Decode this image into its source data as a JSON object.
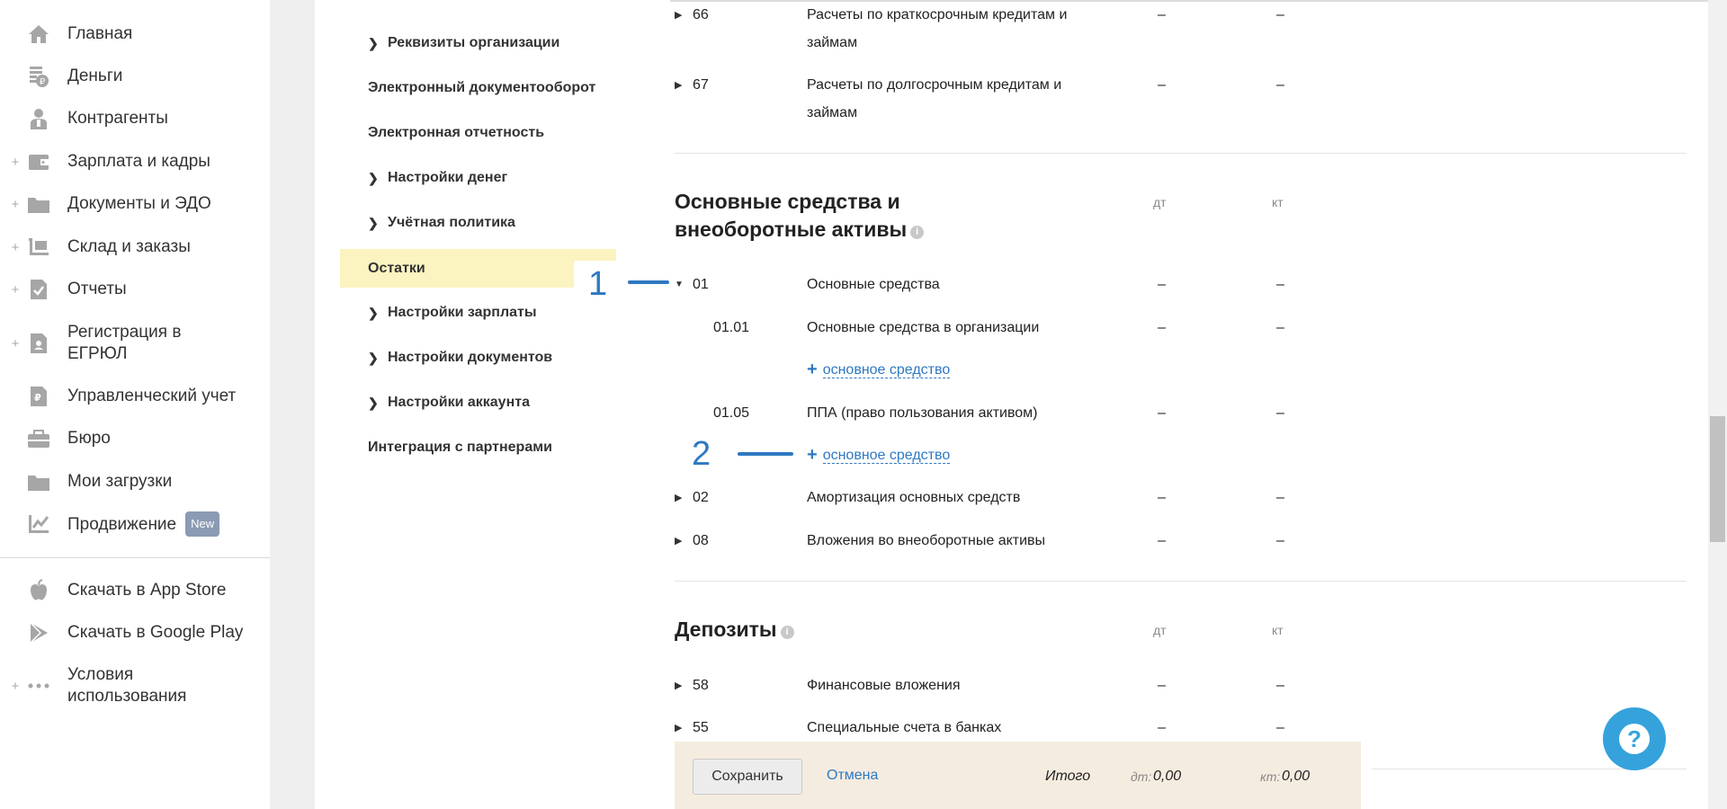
{
  "nav": {
    "items": [
      {
        "label": "Главная",
        "icon": "home-icon",
        "plus": false
      },
      {
        "label": "Деньги",
        "icon": "money-icon",
        "plus": false
      },
      {
        "label": "Контрагенты",
        "icon": "contractors-icon",
        "plus": false
      },
      {
        "label": "Зарплата и кадры",
        "icon": "wallet-icon",
        "plus": true
      },
      {
        "label": "Документы и ЭДО",
        "icon": "folder-icon",
        "plus": true
      },
      {
        "label": "Склад и заказы",
        "icon": "cart-icon",
        "plus": true
      },
      {
        "label": "Отчеты",
        "icon": "report-icon",
        "plus": true
      },
      {
        "label": "Регистрация в ЕГРЮЛ",
        "icon": "registration-icon",
        "plus": true
      },
      {
        "label": "Управленческий учет",
        "icon": "management-icon",
        "plus": false
      },
      {
        "label": "Бюро",
        "icon": "briefcase-icon",
        "plus": false
      },
      {
        "label": "Мои загрузки",
        "icon": "downloads-icon",
        "plus": false
      },
      {
        "label": "Продвижение",
        "icon": "promotion-icon",
        "plus": false,
        "badge": "New"
      },
      {
        "label": "Скачать в App Store",
        "icon": "apple-icon",
        "plus": false
      },
      {
        "label": "Скачать в Google Play",
        "icon": "google-play-icon",
        "plus": false
      },
      {
        "label": "Условия использования",
        "icon": "more-icon",
        "plus": true
      }
    ]
  },
  "settings": {
    "items": [
      {
        "label": "Реквизиты организации",
        "chevron": true
      },
      {
        "label": "Электронный документооборот",
        "chevron": false
      },
      {
        "label": "Электронная отчетность",
        "chevron": false
      },
      {
        "label": "Настройки денег",
        "chevron": true
      },
      {
        "label": "Учётная политика",
        "chevron": true
      },
      {
        "label": "Остатки",
        "chevron": false,
        "active": true
      },
      {
        "label": "Настройки зарплаты",
        "chevron": true
      },
      {
        "label": "Настройки документов",
        "chevron": true
      },
      {
        "label": "Настройки аккаунта",
        "chevron": true
      },
      {
        "label": "Интеграция с партнерами",
        "chevron": false
      }
    ]
  },
  "annotations": [
    "1",
    "2"
  ],
  "accounts": {
    "top_rows": [
      {
        "code": "66",
        "name": "Расчеты по краткосрочным кредитам и займам",
        "dt": "–",
        "kt": "–"
      },
      {
        "code": "67",
        "name": "Расчеты по долгосрочным кредитам и займам",
        "dt": "–",
        "kt": "–"
      }
    ],
    "section1": {
      "title": "Основные средства и внеоборотные активы",
      "dt_header": "дт",
      "kt_header": "кт",
      "rows": [
        {
          "code": "01",
          "name": "Основные средства",
          "dt": "–",
          "kt": "–"
        },
        {
          "code": "01.01",
          "name": "Основные средства в организации",
          "dt": "–",
          "kt": "–"
        },
        {
          "code": "01.05",
          "name": "ППА (право пользования активом)",
          "dt": "–",
          "kt": "–"
        },
        {
          "code": "02",
          "name": "Амортизация основных средств",
          "dt": "–",
          "kt": "–"
        },
        {
          "code": "08",
          "name": "Вложения во внеоборотные активы",
          "dt": "–",
          "kt": "–"
        }
      ],
      "add_link": "основное средство"
    },
    "section2": {
      "title": "Депозиты",
      "dt_header": "дт",
      "kt_header": "кт",
      "rows": [
        {
          "code": "58",
          "name": "Финансовые вложения",
          "dt": "–",
          "kt": "–"
        },
        {
          "code": "55",
          "name": "Специальные счета в банках",
          "dt": "–",
          "kt": "–"
        }
      ]
    }
  },
  "footer": {
    "save": "Сохранить",
    "cancel": "Отмена",
    "total_label": "Итого",
    "dt_label": "дт:",
    "dt_value": "0,00",
    "kt_label": "кт:",
    "kt_value": "0,00"
  },
  "help_label": "?",
  "colors": {
    "accent": "#2e78c2",
    "active_menu": "#fbf3c0",
    "save_bar": "#f5ece0",
    "help_button": "#35a2dc"
  }
}
